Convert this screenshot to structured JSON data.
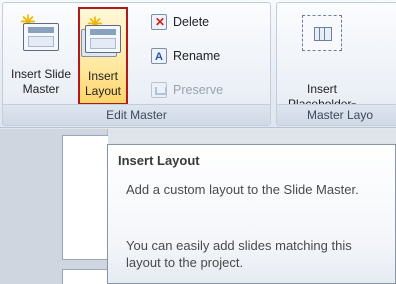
{
  "ribbon": {
    "edit_master": {
      "label": "Edit Master",
      "insert_slide_master": "Insert Slide\nMaster",
      "insert_layout": "Insert\nLayout",
      "delete": "Delete",
      "rename": "Rename",
      "preserve": "Preserve"
    },
    "master_layout": {
      "label": "Master Layo",
      "insert_placeholder": "Insert\nPlaceholder",
      "dropdown_glyph": "▾"
    }
  },
  "tooltip": {
    "title": "Insert Layout",
    "line1": "Add a custom layout to the Slide Master.",
    "line2": "You can easily add slides matching this layout to the project."
  },
  "icons": {
    "sparkle": "✳",
    "accent_red": "#b01a1a"
  }
}
